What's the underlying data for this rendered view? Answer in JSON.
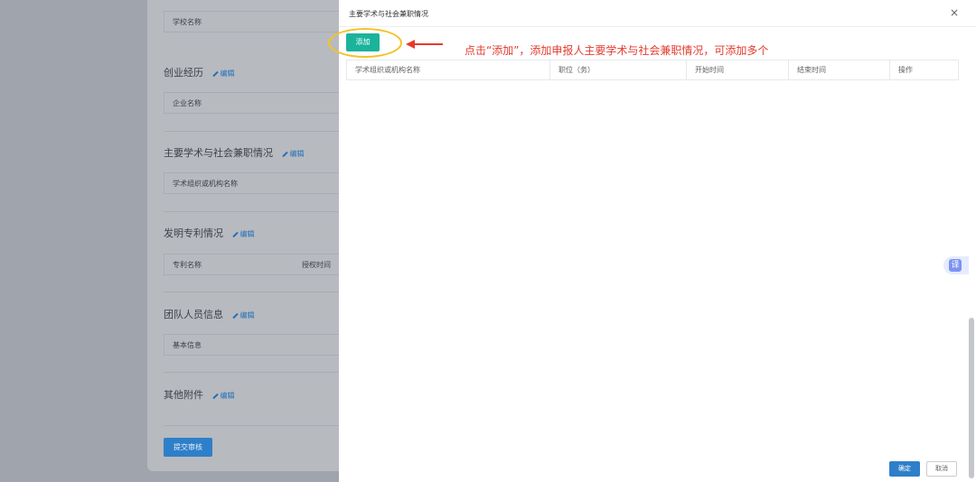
{
  "background": {
    "school_box_label": "学校名称",
    "sections": [
      {
        "title": "创业经历",
        "edit": "编辑",
        "box_label": "企业名称"
      },
      {
        "title": "主要学术与社会兼职情况",
        "edit": "编辑",
        "box_label": "学术组织或机构名称"
      },
      {
        "title": "发明专利情况",
        "edit": "编辑",
        "box_label": "专利名称",
        "box_label_2": "授权时间"
      },
      {
        "title": "团队人员信息",
        "edit": "编辑",
        "box_label": "基本信息"
      },
      {
        "title": "其他附件",
        "edit": "编辑"
      }
    ],
    "submit_label": "提交审核"
  },
  "drawer": {
    "title": "主要学术与社会兼职情况",
    "close_icon": "×",
    "add_label": "添加",
    "annotation": "点击“添加”，添加申报人主要学术与社会兼职情况，可添加多个",
    "table_headers": [
      "学术组织或机构名称",
      "职位（务）",
      "开始时间",
      "结束时间",
      "操作"
    ],
    "confirm_label": "确定",
    "cancel_label": "取消"
  },
  "side_float": {
    "icon": "译"
  },
  "colors": {
    "accent_green": "#1ab39b",
    "primary_blue": "#2e7fc9",
    "annotation_red": "#e43a2e",
    "highlight_yellow": "#f3c325"
  }
}
